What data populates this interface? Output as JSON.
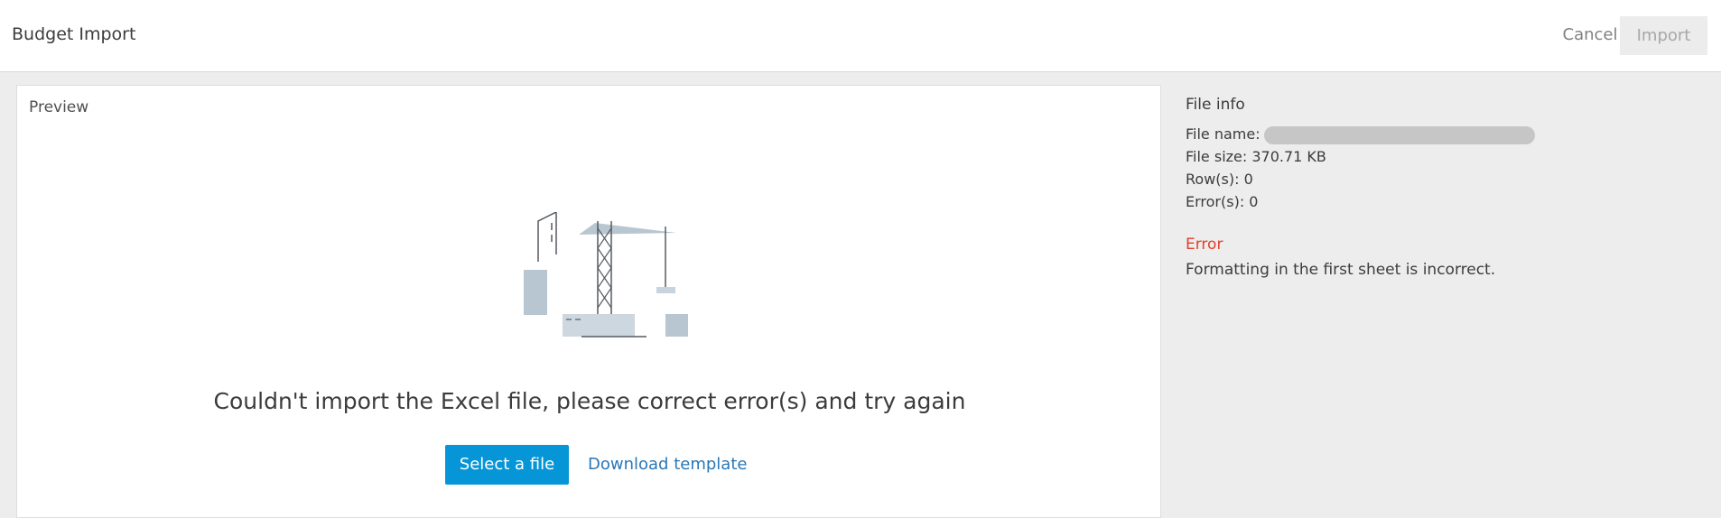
{
  "header": {
    "title": "Budget Import",
    "cancel_label": "Cancel",
    "import_label": "Import"
  },
  "preview": {
    "label": "Preview",
    "illustration_icon": "construction-crane-icon",
    "message": "Couldn't import the Excel file, please correct error(s) and try again",
    "select_file_label": "Select a file",
    "download_template_label": "Download template"
  },
  "file_info": {
    "heading": "File info",
    "file_name_label": "File name:",
    "file_size": "File size: 370.71 KB",
    "rows": "Row(s): 0",
    "errors": "Error(s): 0"
  },
  "error": {
    "heading": "Error",
    "message": "Formatting in the first sheet is incorrect."
  },
  "colors": {
    "primary": "#0696d7",
    "link": "#2977b8",
    "error": "#e0402b",
    "background": "#ededed"
  }
}
